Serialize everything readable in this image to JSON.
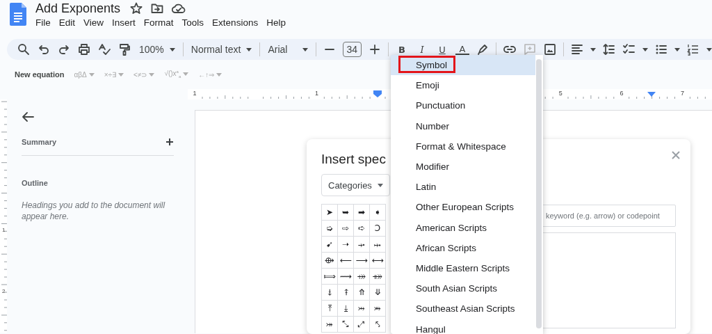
{
  "document": {
    "title": "Add Exponents"
  },
  "menu_bar": [
    "File",
    "Edit",
    "View",
    "Insert",
    "Format",
    "Tools",
    "Extensions",
    "Help"
  ],
  "toolbar": {
    "zoom": "100%",
    "paragraph_style": "Normal text",
    "font": "Arial",
    "font_size": "34",
    "text_format": [
      "B",
      "I",
      "U",
      "A"
    ]
  },
  "equation_toolbar": {
    "new_equation": "New equation",
    "symbol_groups": [
      "αβΔ",
      "×÷∃",
      "<≠⊃",
      "√()x$^{a}$$_{a}$",
      "←↑⇒"
    ]
  },
  "ruler": {
    "horizontal_labels": [
      "1",
      "1",
      "5",
      "6",
      "7"
    ],
    "vertical_labels": [
      "1",
      "2"
    ]
  },
  "sidebar": {
    "summary_label": "Summary",
    "outline_label": "Outline",
    "outline_placeholder": "Headings you add to the document will appear here."
  },
  "dialog": {
    "title": "Insert spec",
    "categories_button": "Categories",
    "search": {
      "placeholder": "keyword (e.g. arrow) or codepoint"
    },
    "symbols": [
      [
        "➤",
        "➥",
        "➡",
        "➧"
      ],
      [
        "➭",
        "⇨",
        "➪",
        "Ↄ"
      ],
      [
        "➹",
        "➝",
        "⤞",
        "⤠"
      ],
      [
        "⟴",
        "⟵",
        "⟶",
        "⟷"
      ],
      [
        "⟾",
        "⟿",
        "⤀",
        "⤁"
      ],
      [
        "⤈",
        "⤉",
        "⤊",
        "⤋"
      ],
      [
        "⤒",
        "⤓",
        "⤔",
        "⤕"
      ],
      [
        "⤖",
        "⤡",
        "⤢",
        "⤣"
      ]
    ]
  },
  "category_menu": {
    "items": [
      {
        "label": "Symbol",
        "selected": true,
        "outlined": true
      },
      {
        "label": "Emoji",
        "selected": false,
        "outlined": false
      },
      {
        "label": "Punctuation",
        "selected": false,
        "outlined": false
      },
      {
        "label": "Number",
        "selected": false,
        "outlined": false
      },
      {
        "label": "Format & Whitespace",
        "selected": false,
        "outlined": false
      },
      {
        "label": "Modifier",
        "selected": false,
        "outlined": false
      },
      {
        "label": "Latin",
        "selected": false,
        "outlined": false
      },
      {
        "label": "Other European Scripts",
        "selected": false,
        "outlined": false
      },
      {
        "label": "American Scripts",
        "selected": false,
        "outlined": false
      },
      {
        "label": "African Scripts",
        "selected": false,
        "outlined": false
      },
      {
        "label": "Middle Eastern Scripts",
        "selected": false,
        "outlined": false
      },
      {
        "label": "South Asian Scripts",
        "selected": false,
        "outlined": false
      },
      {
        "label": "Southeast Asian Scripts",
        "selected": false,
        "outlined": false
      },
      {
        "label": "Hangul",
        "selected": false,
        "outlined": false
      }
    ]
  }
}
